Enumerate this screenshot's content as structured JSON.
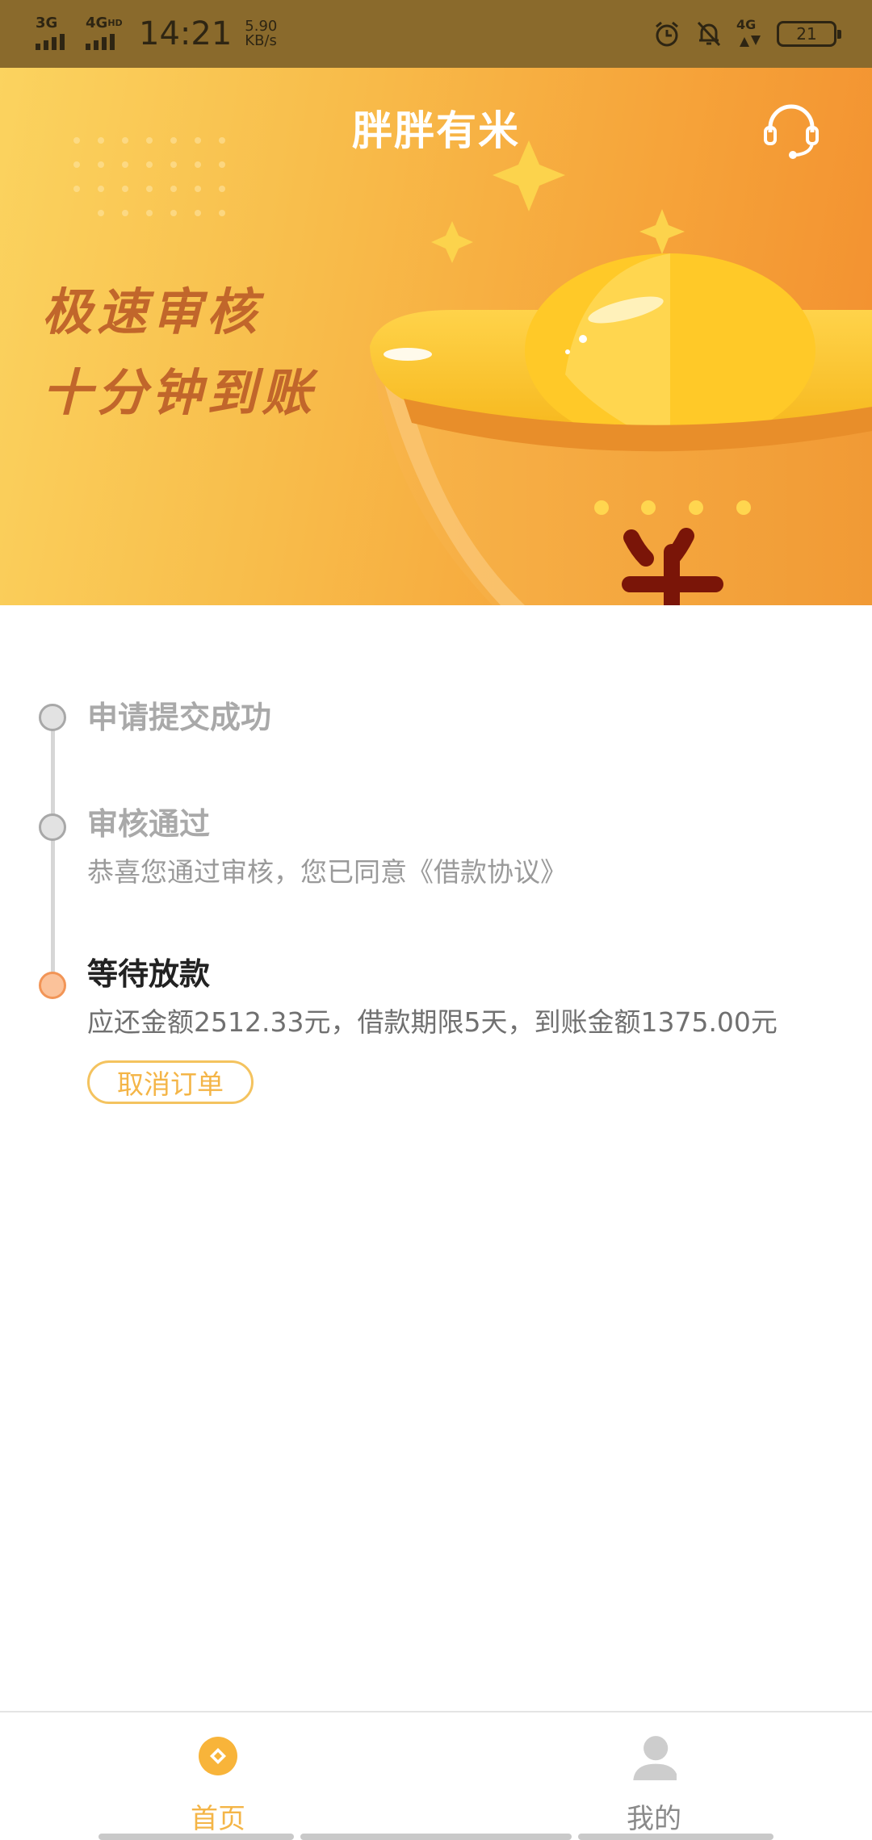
{
  "status_bar": {
    "network_1": "3G",
    "network_2": "4G",
    "network_2_badge": "HD",
    "time": "14:21",
    "speed_value": "5.90",
    "speed_unit": "KB/s",
    "network_3": "4G",
    "battery_level": "21",
    "icons": [
      "alarm-icon",
      "mute-icon",
      "data-arrows-icon",
      "battery-icon"
    ]
  },
  "banner": {
    "app_title": "胖胖有米",
    "slogan_line_1": "极速审核",
    "slogan_line_2": "十分钟到账",
    "support_icon": "headset-icon"
  },
  "timeline": {
    "steps": [
      {
        "title": "申请提交成功",
        "description": "",
        "state": "done"
      },
      {
        "title": "审核通过",
        "description": "恭喜您通过审核，您已同意《借款协议》",
        "state": "done"
      },
      {
        "title": "等待放款",
        "description": "应还金额2512.33元，借款期限5天，到账金额1375.00元",
        "state": "current"
      }
    ],
    "cancel_button_label": "取消订单"
  },
  "bottom_nav": {
    "items": [
      {
        "label": "首页",
        "icon": "home-coin-icon",
        "selected": true
      },
      {
        "label": "我的",
        "icon": "user-icon",
        "selected": false
      }
    ]
  },
  "colors": {
    "accent": "#f4b547",
    "status_bar": "#8a6a2c",
    "slogan": "#c1662b",
    "active_dot": "#fbc29a",
    "inactive_text": "#a9a9a9"
  }
}
